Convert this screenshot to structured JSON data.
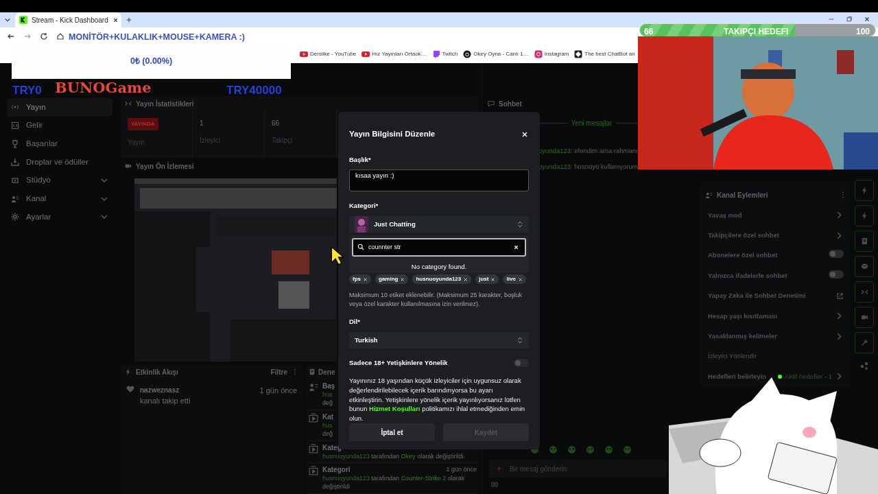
{
  "browser": {
    "tab_title": "Stream - Kick Dashboard",
    "bookmarks": [
      {
        "label": "Derslike - YouTube",
        "kind": "youtube"
      },
      {
        "label": "Hız Yayınları Ortaok…",
        "kind": "youtube"
      },
      {
        "label": "Twitch",
        "kind": "twitch"
      },
      {
        "label": "Okey Oyna - Canlı 1…",
        "kind": "okey"
      },
      {
        "label": "Instagram",
        "kind": "instagram"
      },
      {
        "label": "The best ChatBot an",
        "kind": "bot"
      }
    ]
  },
  "sidebar": {
    "items": [
      {
        "label": "Yayın",
        "kind": "live",
        "selected": true,
        "expandable": false
      },
      {
        "label": "Gelir",
        "kind": "money",
        "selected": false,
        "expandable": false
      },
      {
        "label": "Başarılar",
        "kind": "trophy",
        "selected": false,
        "expandable": false
      },
      {
        "label": "Droplar ve ödüller",
        "kind": "drop",
        "selected": false,
        "expandable": false
      },
      {
        "label": "Stüdyo",
        "kind": "studio",
        "selected": false,
        "expandable": true
      },
      {
        "label": "Kanal",
        "kind": "people",
        "selected": false,
        "expandable": true
      },
      {
        "label": "Ayarlar",
        "kind": "gear",
        "selected": false,
        "expandable": true
      }
    ]
  },
  "stats": {
    "title": "Yayın İstatistikleri",
    "items": [
      {
        "value": "YAYINDA",
        "label": "Yayın",
        "kind": "badge"
      },
      {
        "value": "1",
        "label": "İzleyici",
        "kind": "number"
      },
      {
        "value": "66",
        "label": "Takipçi",
        "kind": "number"
      }
    ]
  },
  "preview": {
    "title": "Yayın Ön İzlemesi"
  },
  "activity": {
    "title": "Etkinlik Akışı",
    "filter": "Filtre",
    "events": [
      {
        "user": "nazweznasz",
        "action": "kanalı takip etti",
        "time": "1 gün önce"
      }
    ]
  },
  "moderation": {
    "title": "Dene",
    "entries": [
      {
        "title": "Baş",
        "lines": [
          [
            {
              "text": "hus",
              "kind": "user"
            }
          ],
          [
            {
              "text": "değ",
              "kind": "plain"
            }
          ]
        ]
      },
      {
        "title": "Kat",
        "lines": [
          [
            {
              "text": "hus",
              "kind": "user"
            }
          ],
          [
            {
              "text": "değ",
              "kind": "plain"
            }
          ]
        ]
      },
      {
        "title": "Kateg",
        "lines": [
          [
            {
              "text": "husnuoyunda123",
              "kind": "user"
            },
            {
              "text": " tarafından ",
              "kind": "plain"
            },
            {
              "text": "Okey",
              "kind": "value"
            },
            {
              "text": " olarak değiştirildi.",
              "kind": "plain"
            }
          ]
        ]
      },
      {
        "title": "Kategori",
        "time": "1 gün önce",
        "lines": [
          [
            {
              "text": "husnuoyunda123",
              "kind": "user"
            },
            {
              "text": " tarafından ",
              "kind": "plain"
            },
            {
              "text": "Counter-Strike 2",
              "kind": "value"
            },
            {
              "text": " olarak",
              "kind": "plain"
            }
          ],
          [
            {
              "text": "değiştirildi",
              "kind": "plain"
            }
          ]
        ]
      }
    ]
  },
  "chat": {
    "title": "Sohbet",
    "divider": "Yeni mesajlar",
    "messages": [
      {
        "user": "oyunda123",
        "text": ": efendim ama rahmanı"
      },
      {
        "user": "oyunda123",
        "text": ": hüsnüyü kullanıyorum"
      }
    ],
    "placeholder": "Bir mesaj gönderin"
  },
  "actions": {
    "title": "Kanal Eylemleri",
    "items": [
      {
        "label": "Yavaş mod",
        "kind": "chevron"
      },
      {
        "label": "Takipçilere özel sohbet",
        "kind": "chevron"
      },
      {
        "label": "Abonelere özel sohbet",
        "kind": "toggle",
        "on": false
      },
      {
        "label": "Yalnızca ifadelerle sohbet",
        "kind": "toggle",
        "on": false
      },
      {
        "label": "Yapay Zeka ile Sohbet Denetimi",
        "kind": "external"
      },
      {
        "label": "Hesap yaşı kısıtlaması",
        "kind": "chevron"
      },
      {
        "label": "Yasaklanmış kelimeler",
        "kind": "chevron"
      }
    ],
    "section": "İzleyici Yönlendir",
    "goal_label": "Hedefleri belirleyin",
    "goal_status": "Aktif hedefler - 1",
    "goal_active": true
  },
  "modal": {
    "title": "Yayın Bilgisini Düzenle",
    "title_label": "Başlık*",
    "title_value": "kısaa yayın :)",
    "category_label": "Kategori*",
    "category": "Just Chatting",
    "search_value": "counnter str",
    "search_result": "No category found.",
    "tags": [
      "fps",
      "gaming",
      "husnuoyunda123",
      "just",
      "live"
    ],
    "tags_hint": "Maksimum 10 etiket eklenebilir. (Maksimum 25 karakter, boşluk veya özel karakter kullanılmasına izin verilmez).",
    "language_label": "Dil*",
    "language": "Turkish",
    "mature_label": "Sadece 18+ Yetişkinlere Yönelik",
    "mature_on": false,
    "note_start": "Yayınınız 18 yaşından küçük izleyiciler için uygunsuz olarak değerlendirilebilecek içerik barındırıyorsa bu ayarı etkinleştirin. Yetişkinlere yönelik içerik yayınlıyorsanız lütfen bunun ",
    "terms_link": "Hizmet Koşulları",
    "note_end": " politikamızı ihlal etmediğinden emin olun.",
    "cancel": "İptal et",
    "save": "Kaydet",
    "save_disabled": true
  },
  "overlays": {
    "donation_title": "MONİTÖR+KULAKLIK+MOUSE+KAMERA :)",
    "donation_amount": "0₺ (0.00%)",
    "donation_start": "TRY0",
    "donation_goal": "TRY40000",
    "logo": "BUNOGame",
    "follower_goal": {
      "current": "66",
      "label": "TAKIPÇI HEDEFI",
      "target": "100",
      "level": 0.66
    }
  }
}
